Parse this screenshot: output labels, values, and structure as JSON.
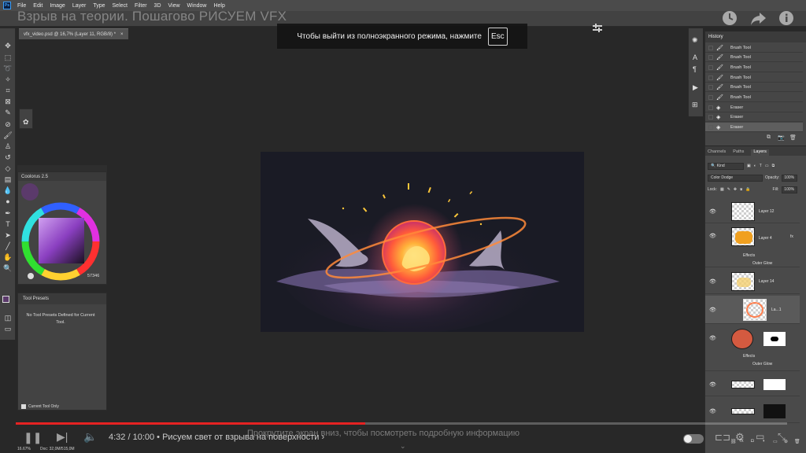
{
  "menu": [
    "File",
    "Edit",
    "Image",
    "Layer",
    "Type",
    "Select",
    "Filter",
    "3D",
    "View",
    "Window",
    "Help"
  ],
  "video_title": "Взрыв на теории. Пошагово РИСУЕМ VFX",
  "doc_tab": {
    "label": "vfx_video.psd @ 16,7% (Layer 11, RGB/8) *",
    "close": "×"
  },
  "fullscreen_notice": {
    "text": "Чтобы выйти из полноэкранного режима, нажмите",
    "key": "Esc"
  },
  "coolorus": {
    "title": "Coolorus 2.5",
    "value": "57346"
  },
  "tool_presets": {
    "title": "Tool Presets",
    "empty_text": "No Tool Presets Defined for Current Tool.",
    "current_only": "Current Tool Only"
  },
  "history": {
    "title": "History",
    "items": [
      {
        "label": "Brush Tool",
        "icon": "brush-icon"
      },
      {
        "label": "Brush Tool",
        "icon": "brush-icon"
      },
      {
        "label": "Brush Tool",
        "icon": "brush-icon"
      },
      {
        "label": "Brush Tool",
        "icon": "brush-icon"
      },
      {
        "label": "Brush Tool",
        "icon": "brush-icon"
      },
      {
        "label": "Brush Tool",
        "icon": "brush-icon"
      },
      {
        "label": "Eraser",
        "icon": "eraser-icon"
      },
      {
        "label": "Eraser",
        "icon": "eraser-icon"
      },
      {
        "label": "Eraser",
        "icon": "eraser-icon"
      }
    ]
  },
  "layers_panel": {
    "tabs": [
      "Channels",
      "Paths",
      "Layers"
    ],
    "active_tab": "Layers",
    "kind": "Kind",
    "blend_mode": "Color Dodge",
    "opacity_label": "Opacity:",
    "opacity": "100%",
    "lock_label": "Lock:",
    "fill_label": "Fill:",
    "fill": "100%",
    "layers": [
      {
        "name": "Layer 12"
      },
      {
        "name": "Layer 4",
        "effects": "Effects",
        "effect": "Outer Glow"
      },
      {
        "name": "Layer 14"
      },
      {
        "name": "La...1"
      },
      {
        "name": "",
        "effects": "Effects",
        "effect": "Outer Glow"
      },
      {
        "name": ""
      },
      {
        "name": ""
      }
    ]
  },
  "status": {
    "zoom": "16.67%",
    "doc": "Doc: 32,0M/515,0M"
  },
  "player": {
    "time": "4:32 / 10:00",
    "chapter": "Рисуем свет от взрыва на поверхности",
    "scroll_hint": "Прокрутите экран вниз, чтобы посмотреть подробную информацию",
    "progress": 0.4533
  },
  "colors": {
    "accent": "#e52222",
    "swatch": "#5b3a6b"
  }
}
